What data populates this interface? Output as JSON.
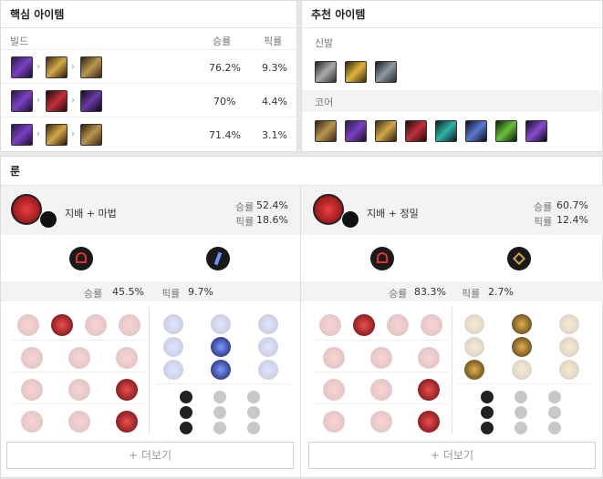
{
  "core_items": {
    "title": "핵심 아이템",
    "headers": {
      "build": "빌드",
      "winrate": "승률",
      "pickrate": "픽률"
    },
    "rows": [
      {
        "winrate": "76.2%",
        "pickrate": "9.3%",
        "items": [
          "purple-staff-icon",
          "gold-blade-icon",
          "gold-bow-icon"
        ]
      },
      {
        "winrate": "70%",
        "pickrate": "4.4%",
        "items": [
          "purple-staff-icon",
          "red-sword-icon",
          "dark-blade-icon"
        ]
      },
      {
        "winrate": "71.4%",
        "pickrate": "3.1%",
        "items": [
          "purple-staff-icon",
          "gold-blade-icon",
          "gold-bow-icon"
        ]
      }
    ]
  },
  "recommended": {
    "title": "추천 아이템",
    "boots_label": "신발",
    "core_label": "코어",
    "boots": [
      "silver-boots-icon",
      "gold-boots-icon",
      "steel-boots-icon"
    ],
    "core": [
      "gold-bow-icon",
      "purple-staff-icon",
      "gold-blade-icon",
      "red-sword-icon",
      "teal-blade-icon",
      "blue-sword-icon",
      "green-blade-icon",
      "purple-shadow-icon"
    ]
  },
  "runes": {
    "title": "룬",
    "sets": [
      {
        "name": "지배 + 마법",
        "winrate_label": "승률",
        "winrate": "52.4%",
        "pickrate_label": "픽률",
        "pickrate": "18.6%",
        "primary_icon": "domination-tree-icon",
        "secondary_icon": "sorcery-tree-icon",
        "stat_winrate_label": "승률",
        "stat_winrate": "45.5%",
        "stat_pickrate_label": "픽률",
        "stat_pickrate": "9.7%",
        "more_label": "+ 더보기"
      },
      {
        "name": "지배 + 정밀",
        "winrate_label": "승률",
        "winrate": "60.7%",
        "pickrate_label": "픽률",
        "pickrate": "12.4%",
        "primary_icon": "domination-tree-icon",
        "secondary_icon": "precision-tree-icon",
        "stat_winrate_label": "승률",
        "stat_winrate": "83.3%",
        "stat_pickrate_label": "픽률",
        "stat_pickrate": "2.7%",
        "more_label": "+ 더보기"
      }
    ]
  },
  "colors": {
    "accent_red": "#b3121f",
    "item_gold": "#b08a2e",
    "item_purple": "#5a2a8a"
  }
}
